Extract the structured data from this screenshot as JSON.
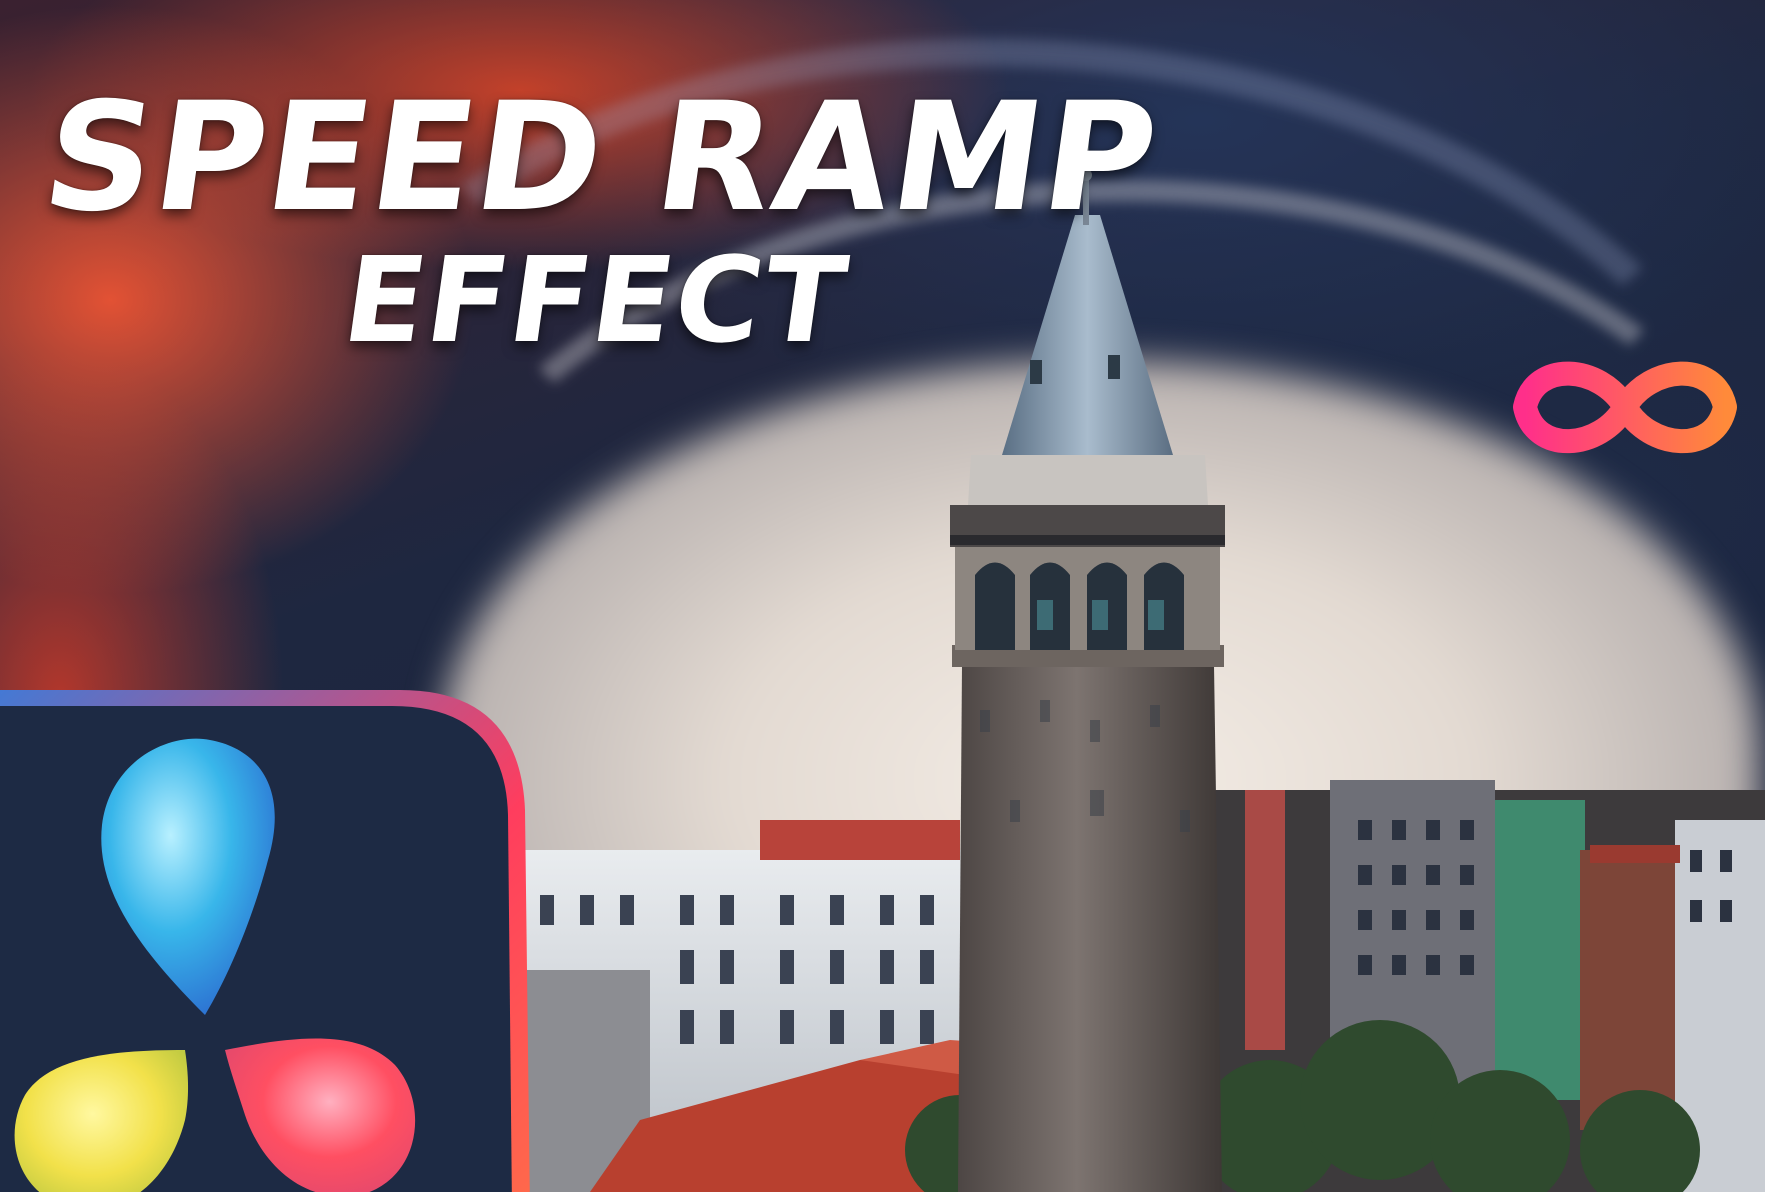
{
  "headline": {
    "line1": "SPEED RAMP",
    "line2": "EFFECT"
  },
  "icons": {
    "infinity": "infinity-logo-icon",
    "resolve": "davinci-resolve-logo-icon"
  },
  "colors": {
    "title_text": "#ffffff",
    "infinity_start": "#ff2f8a",
    "infinity_end": "#ff8a3a",
    "resolve_frame": "#ff3d5e",
    "resolve_tile": "#1d2a44",
    "resolve_blue": "#38b6ea",
    "resolve_yellow": "#f2e14a",
    "resolve_red": "#ff4f62"
  }
}
